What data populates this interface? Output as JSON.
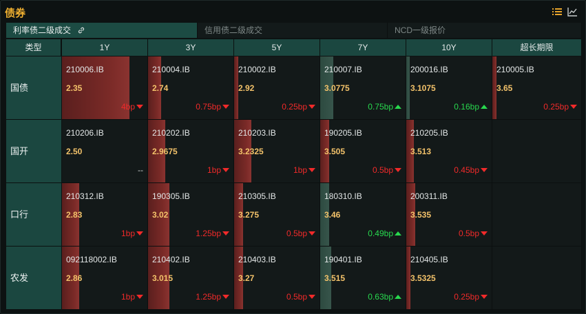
{
  "header": {
    "title": "债券",
    "icons": [
      "list-icon",
      "line-chart-icon"
    ],
    "accent": "#f0b030"
  },
  "tabs": [
    {
      "label": "利率债二级成交",
      "active": true,
      "icon": "link-icon"
    },
    {
      "label": "信用债二级成交",
      "active": false
    },
    {
      "label": "NCD一级报价",
      "active": false
    }
  ],
  "table": {
    "corner_label": "类型",
    "columns": [
      "1Y",
      "3Y",
      "5Y",
      "7Y",
      "10Y",
      "超长期限"
    ],
    "rows": [
      {
        "label": "国债",
        "cells": [
          {
            "code": "210006.IB",
            "yield": "2.35",
            "change": "4bp",
            "dir": "down",
            "level": 0.78
          },
          {
            "code": "210004.IB",
            "yield": "2.74",
            "change": "0.75bp",
            "dir": "down",
            "level": 0.15
          },
          {
            "code": "210002.IB",
            "yield": "2.92",
            "change": "0.25bp",
            "dir": "down",
            "level": 0.05
          },
          {
            "code": "210007.IB",
            "yield": "3.0775",
            "change": "0.75bp",
            "dir": "up",
            "level": 0.15
          },
          {
            "code": "200016.IB",
            "yield": "3.1075",
            "change": "0.16bp",
            "dir": "up",
            "level": 0.03
          },
          {
            "code": "210005.IB",
            "yield": "3.65",
            "change": "0.25bp",
            "dir": "down",
            "level": 0.05
          }
        ]
      },
      {
        "label": "国开",
        "cells": [
          {
            "code": "210206.IB",
            "yield": "2.50",
            "change": "--",
            "dir": "flat",
            "level": 0
          },
          {
            "code": "210202.IB",
            "yield": "2.9675",
            "change": "1bp",
            "dir": "down",
            "level": 0.2
          },
          {
            "code": "210203.IB",
            "yield": "3.2325",
            "change": "1bp",
            "dir": "down",
            "level": 0.2
          },
          {
            "code": "190205.IB",
            "yield": "3.505",
            "change": "0.5bp",
            "dir": "down",
            "level": 0.1
          },
          {
            "code": "210205.IB",
            "yield": "3.513",
            "change": "0.45bp",
            "dir": "down",
            "level": 0.09
          },
          null
        ]
      },
      {
        "label": "口行",
        "cells": [
          {
            "code": "210312.IB",
            "yield": "2.83",
            "change": "1bp",
            "dir": "down",
            "level": 0.2
          },
          {
            "code": "190305.IB",
            "yield": "3.02",
            "change": "1.25bp",
            "dir": "down",
            "level": 0.25
          },
          {
            "code": "210305.IB",
            "yield": "3.275",
            "change": "0.5bp",
            "dir": "down",
            "level": 0.1
          },
          {
            "code": "180310.IB",
            "yield": "3.46",
            "change": "0.49bp",
            "dir": "up",
            "level": 0.1
          },
          {
            "code": "200311.IB",
            "yield": "3.535",
            "change": "0.5bp",
            "dir": "down",
            "level": 0.1
          },
          null
        ]
      },
      {
        "label": "农发",
        "cells": [
          {
            "code": "092118002.IB",
            "yield": "2.86",
            "change": "1bp",
            "dir": "down",
            "level": 0.2
          },
          {
            "code": "210402.IB",
            "yield": "3.015",
            "change": "1.25bp",
            "dir": "down",
            "level": 0.25
          },
          {
            "code": "210403.IB",
            "yield": "3.27",
            "change": "0.5bp",
            "dir": "down",
            "level": 0.1
          },
          {
            "code": "190401.IB",
            "yield": "3.515",
            "change": "0.63bp",
            "dir": "up",
            "level": 0.13
          },
          {
            "code": "210405.IB",
            "yield": "3.5325",
            "change": "0.25bp",
            "dir": "down",
            "level": 0.05
          },
          null
        ]
      }
    ]
  },
  "colors": {
    "down": "#f12a2a",
    "up": "#28d84e",
    "yield": "#f3c26a",
    "header_bg": "#1b4740"
  }
}
